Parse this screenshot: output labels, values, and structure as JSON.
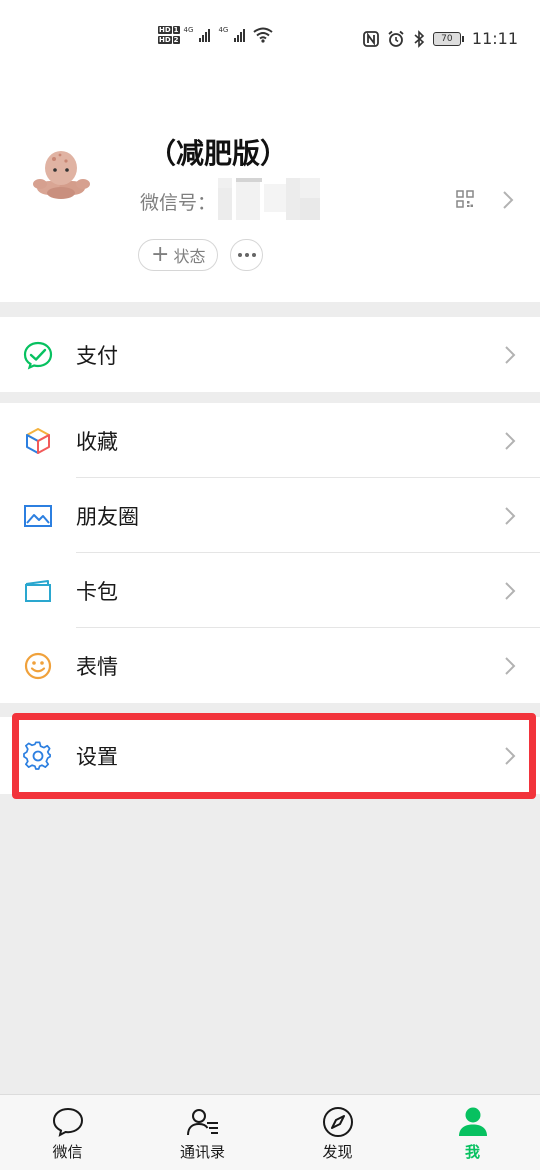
{
  "status_bar": {
    "hd1": "HD",
    "sim1": "1",
    "hd2": "HD",
    "sim2": "2",
    "net1": "4G",
    "net2": "4G",
    "battery": "70",
    "time": "11:11"
  },
  "profile": {
    "nickname": "（减肥版）",
    "wxid_label": "微信号：",
    "status_button": "状态"
  },
  "menu": {
    "pay": "支付",
    "favorites": "收藏",
    "moments": "朋友圈",
    "cards": "卡包",
    "stickers": "表情",
    "settings": "设置"
  },
  "tabbar": {
    "chats": "微信",
    "contacts": "通讯录",
    "discover": "发现",
    "me": "我"
  },
  "colors": {
    "accent_green": "#07c160",
    "highlight_red": "#f2333b",
    "background": "#ededed"
  }
}
